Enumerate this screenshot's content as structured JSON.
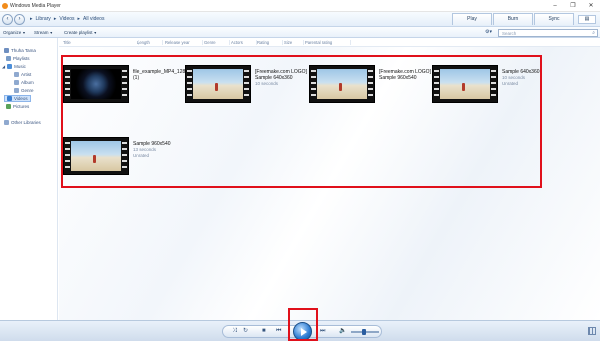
{
  "window": {
    "title": "Windows Media Player",
    "controls": [
      "–",
      "❐",
      "✕"
    ]
  },
  "nav": {
    "breadcrumb": [
      "Library",
      "Videos",
      "All videos"
    ],
    "tabs": [
      "Play",
      "Burn",
      "Sync"
    ]
  },
  "toolbar": {
    "organize": "Organize",
    "stream": "Stream",
    "create_playlist": "Create playlist",
    "search_placeholder": "Search"
  },
  "sidebar": {
    "items": [
      {
        "label": "Thuha Tama",
        "icon": "user-icon",
        "color": "#6f8fc0"
      },
      {
        "label": "Playlists",
        "icon": "playlist-icon",
        "color": "#7a9cc8"
      },
      {
        "label": "Music",
        "icon": "music-icon",
        "color": "#4c8ed9"
      },
      {
        "label": "Artist",
        "icon": "artist-icon",
        "color": "#8fa9cf"
      },
      {
        "label": "Album",
        "icon": "album-icon",
        "color": "#8fa9cf"
      },
      {
        "label": "Genre",
        "icon": "genre-icon",
        "color": "#8fa9cf"
      },
      {
        "label": "Videos",
        "icon": "video-icon",
        "color": "#3b7fd0"
      },
      {
        "label": "Pictures",
        "icon": "picture-icon",
        "color": "#5aa35a"
      },
      {
        "label": "Other Libraries",
        "icon": "libraries-icon",
        "color": "#8fa9cf"
      }
    ]
  },
  "columns": [
    "Title",
    "Length",
    "Release year",
    "Genre",
    "Actors",
    "Rating",
    "Size",
    "Parental rating"
  ],
  "videos": [
    {
      "name": "file_example_MP4_1280_10MG (1)",
      "duration": "",
      "rating": ""
    },
    {
      "name": "[Freemake.com LOGO] Sample 640x360",
      "duration": "10 seconds",
      "rating": ""
    },
    {
      "name": "[Freemake.com LOGO] Sample 960x540",
      "duration": "",
      "rating": ""
    },
    {
      "name": "Sample 640x360",
      "duration": "10 seconds",
      "rating": "Unrated"
    },
    {
      "name": "Sample 960x540",
      "duration": "13 seconds",
      "rating": "Unrated"
    }
  ],
  "player": {
    "shuffle": "⤨",
    "repeat": "↻",
    "stop": "■",
    "previous": "⏮",
    "next": "⏭",
    "mute": "🔈"
  },
  "colors": {
    "highlight": "#e0101b",
    "play_button": "#2b7bd2"
  }
}
